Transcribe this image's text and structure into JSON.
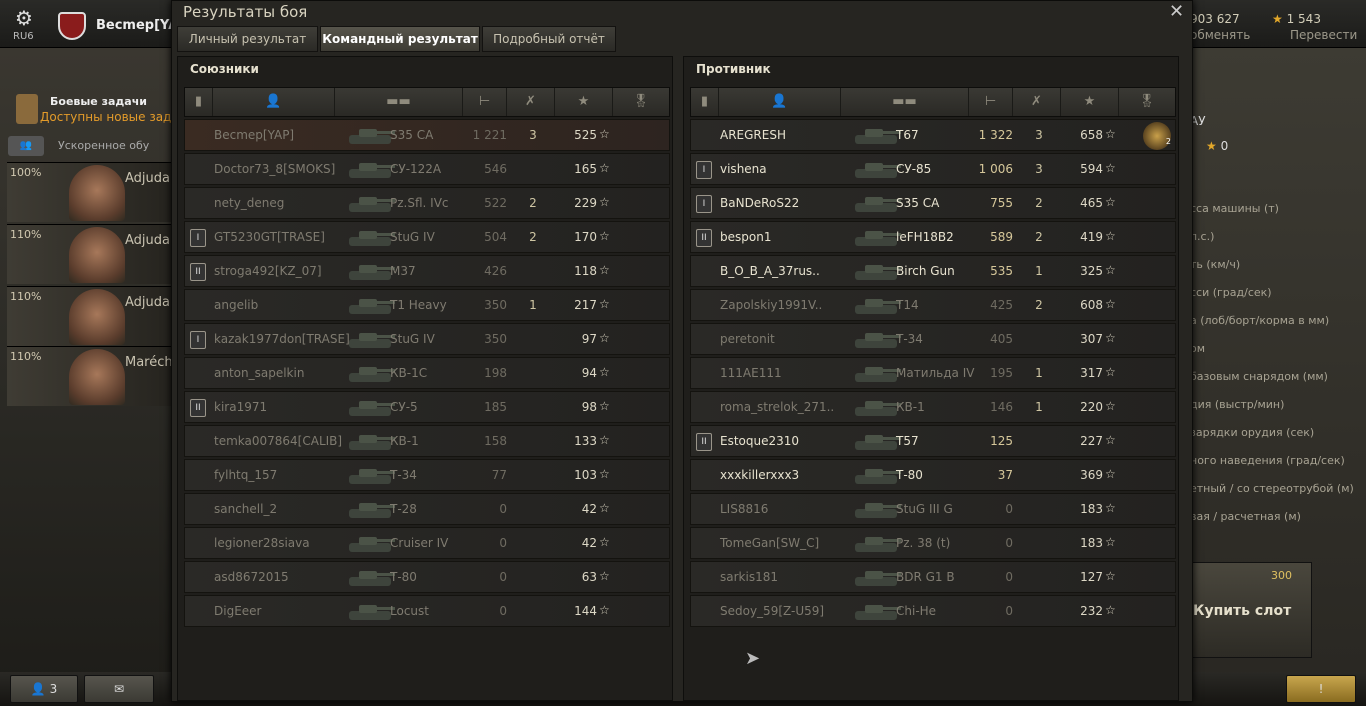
{
  "topbar": {
    "server": "RU6",
    "player": "Becmep[YAP",
    "credits": "903 627",
    "credits_action": "обменять",
    "gold": "1 543",
    "gold_action": "Перевести"
  },
  "left": {
    "missions_title": "Боевые задачи",
    "missions_sub": "Доступны новые задачи",
    "accelerated": "Ускоренное обу",
    "crew": [
      {
        "pct": "100%",
        "name": "Adjudant"
      },
      {
        "pct": "110%",
        "name": "Adjudant"
      },
      {
        "pct": "110%",
        "name": "Adjudant"
      },
      {
        "pct": "110%",
        "name": "Marécha"
      }
    ]
  },
  "right": {
    "stats": [
      "сса машины (т)",
      "л.с.)",
      "ть (км/ч)",
      "сси (град/сек)",
      "а (лоб/борт/корма в мм)",
      "ом",
      "базовым снарядом (мм)",
      "дия (выстр/мин)",
      "зарядки орудия (сек)",
      "ного наведения (град/сек)",
      "етный / со стереотрубой (м)",
      "вая / расчетная (м)"
    ],
    "vehicle_short": "АУ",
    "vehicle_gold": "0",
    "slot_price": "300",
    "buy_slot": "Купить слот"
  },
  "bottom": {
    "players_count": "3"
  },
  "dialog": {
    "title": "Результаты боя",
    "close": "✕",
    "tabs": [
      "Личный результат",
      "Командный результат",
      "Подробный отчёт"
    ],
    "allies_title": "Союзники",
    "enemies_title": "Противник",
    "allies": [
      {
        "name": "Becmep[YAP]",
        "vehicle": "S35 CA",
        "damage": "1 221",
        "kills": "3",
        "xp": "525",
        "badge": "",
        "status": "dead",
        "me": true
      },
      {
        "name": "Doctor73_8[SMOKS]",
        "vehicle": "СУ-122А",
        "damage": "546",
        "kills": "",
        "xp": "165",
        "badge": "",
        "status": "dead"
      },
      {
        "name": "nety_deneg",
        "vehicle": "Pz.Sfl. IVc",
        "damage": "522",
        "kills": "2",
        "xp": "229",
        "badge": "",
        "status": "dead"
      },
      {
        "name": "GT5230GT[TRASE]",
        "vehicle": "StuG IV",
        "damage": "504",
        "kills": "2",
        "xp": "170",
        "badge": "I",
        "status": "dead"
      },
      {
        "name": "stroga492[KZ_07]",
        "vehicle": "M37",
        "damage": "426",
        "kills": "",
        "xp": "118",
        "badge": "II",
        "status": "dead"
      },
      {
        "name": "angelib",
        "vehicle": "T1 Heavy",
        "damage": "350",
        "kills": "1",
        "xp": "217",
        "badge": "",
        "status": "dead"
      },
      {
        "name": "kazak1977don[TRASE]",
        "vehicle": "StuG IV",
        "damage": "350",
        "kills": "",
        "xp": "97",
        "badge": "I",
        "status": "dead"
      },
      {
        "name": "anton_sapelkin",
        "vehicle": "КВ-1С",
        "damage": "198",
        "kills": "",
        "xp": "94",
        "badge": "",
        "status": "dead"
      },
      {
        "name": "kira1971",
        "vehicle": "СУ-5",
        "damage": "185",
        "kills": "",
        "xp": "98",
        "badge": "II",
        "status": "dead"
      },
      {
        "name": "temka007864[CALIB]",
        "vehicle": "КВ-1",
        "damage": "158",
        "kills": "",
        "xp": "133",
        "badge": "",
        "status": "dead"
      },
      {
        "name": "fylhtq_157",
        "vehicle": "Т-34",
        "damage": "77",
        "kills": "",
        "xp": "103",
        "badge": "",
        "status": "dead"
      },
      {
        "name": "sanchell_2",
        "vehicle": "Т-28",
        "damage": "0",
        "kills": "",
        "xp": "42",
        "badge": "",
        "status": "dead"
      },
      {
        "name": "legioner28siava",
        "vehicle": "Cruiser IV",
        "damage": "0",
        "kills": "",
        "xp": "42",
        "badge": "",
        "status": "dead"
      },
      {
        "name": "asd8672015",
        "vehicle": "Т-80",
        "damage": "0",
        "kills": "",
        "xp": "63",
        "badge": "",
        "status": "dead"
      },
      {
        "name": "DigEeer",
        "vehicle": "Locust",
        "damage": "0",
        "kills": "",
        "xp": "144",
        "badge": "",
        "status": "dead"
      }
    ],
    "enemies": [
      {
        "name": "AREGRESH",
        "vehicle": "T67",
        "damage": "1 322",
        "kills": "3",
        "xp": "658",
        "badge": "",
        "status": "alive",
        "ach": "2"
      },
      {
        "name": "vishena",
        "vehicle": "СУ-85",
        "damage": "1 006",
        "kills": "3",
        "xp": "594",
        "badge": "I",
        "status": "alive"
      },
      {
        "name": "BaNDeRoS22",
        "vehicle": "S35 CA",
        "damage": "755",
        "kills": "2",
        "xp": "465",
        "badge": "I",
        "status": "alive"
      },
      {
        "name": "bespon1",
        "vehicle": "leFH18B2",
        "damage": "589",
        "kills": "2",
        "xp": "419",
        "badge": "II",
        "status": "alive"
      },
      {
        "name": "B_O_B_A_37rus..",
        "vehicle": "Birch Gun",
        "damage": "535",
        "kills": "1",
        "xp": "325",
        "badge": "",
        "status": "alive"
      },
      {
        "name": "Zapolskiy1991V..",
        "vehicle": "T14",
        "damage": "425",
        "kills": "2",
        "xp": "608",
        "badge": "",
        "status": "dead"
      },
      {
        "name": "peretonit",
        "vehicle": "Т-34",
        "damage": "405",
        "kills": "",
        "xp": "307",
        "badge": "",
        "status": "dead"
      },
      {
        "name": "111AE111",
        "vehicle": "Матильда IV",
        "damage": "195",
        "kills": "1",
        "xp": "317",
        "badge": "",
        "status": "dead"
      },
      {
        "name": "roma_strelok_271..",
        "vehicle": "КВ-1",
        "damage": "146",
        "kills": "1",
        "xp": "220",
        "badge": "",
        "status": "dead"
      },
      {
        "name": "Estoque2310",
        "vehicle": "T57",
        "damage": "125",
        "kills": "",
        "xp": "227",
        "badge": "II",
        "status": "alive"
      },
      {
        "name": "xxxkillerxxx3",
        "vehicle": "Т-80",
        "damage": "37",
        "kills": "",
        "xp": "369",
        "badge": "",
        "status": "alive"
      },
      {
        "name": "LIS8816",
        "vehicle": "StuG III G",
        "damage": "0",
        "kills": "",
        "xp": "183",
        "badge": "",
        "status": "dead"
      },
      {
        "name": "TomeGan[SW_C]",
        "vehicle": "Pz. 38 (t)",
        "damage": "0",
        "kills": "",
        "xp": "183",
        "badge": "",
        "status": "dead"
      },
      {
        "name": "sarkis181",
        "vehicle": "BDR G1 B",
        "damage": "0",
        "kills": "",
        "xp": "127",
        "badge": "",
        "status": "dead"
      },
      {
        "name": "Sedoy_59[Z-U59]",
        "vehicle": "Chi-He",
        "damage": "0",
        "kills": "",
        "xp": "232",
        "badge": "",
        "status": "dead"
      }
    ]
  }
}
